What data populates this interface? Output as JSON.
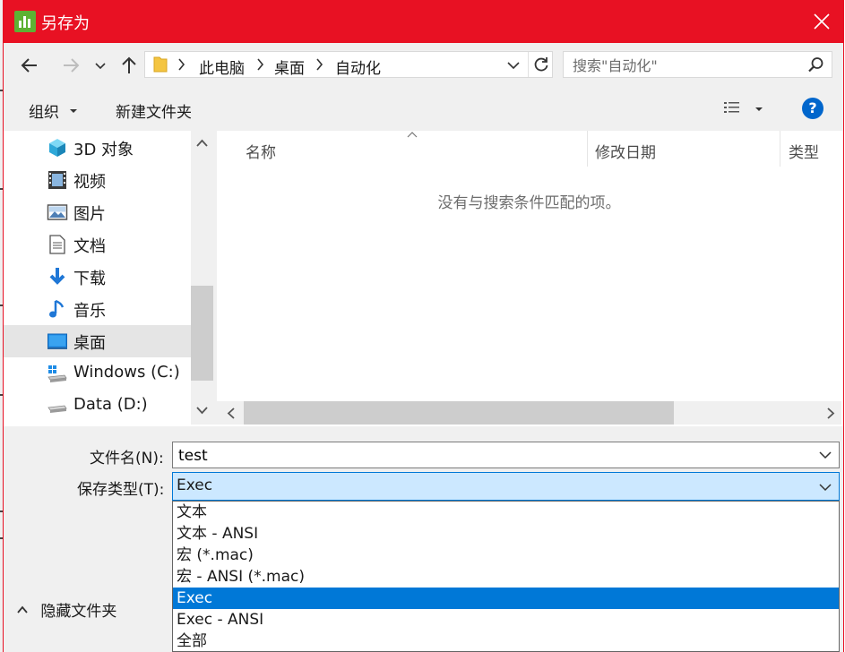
{
  "window": {
    "title": "另存为",
    "accent_color": "#e81123",
    "title_icon": "bar-chart-app-icon"
  },
  "navigation": {
    "back_icon": "arrow-left-icon",
    "forward_icon": "arrow-right-icon",
    "recent_icon": "chevron-down-icon",
    "up_icon": "arrow-up-icon",
    "breadcrumb": [
      "此电脑",
      "桌面",
      "自动化"
    ],
    "refresh_icon": "refresh-icon",
    "search_placeholder": "搜索\"自动化\""
  },
  "toolbar": {
    "organize_label": "组织",
    "new_folder_label": "新建文件夹",
    "help_label": "?"
  },
  "sidebar": {
    "items": [
      {
        "label": "3D 对象",
        "icon": "cube-3d-icon",
        "selected": false
      },
      {
        "label": "视频",
        "icon": "film-icon",
        "selected": false
      },
      {
        "label": "图片",
        "icon": "picture-icon",
        "selected": false
      },
      {
        "label": "文档",
        "icon": "document-icon",
        "selected": false
      },
      {
        "label": "下载",
        "icon": "download-arrow-icon",
        "selected": false
      },
      {
        "label": "音乐",
        "icon": "music-note-icon",
        "selected": false
      },
      {
        "label": "桌面",
        "icon": "desktop-icon",
        "selected": true
      },
      {
        "label": "Windows (C:)",
        "icon": "windows-drive-icon",
        "selected": false
      },
      {
        "label": "Data (D:)",
        "icon": "drive-icon",
        "selected": false
      }
    ]
  },
  "file_list": {
    "columns": [
      "名称",
      "修改日期",
      "类型"
    ],
    "empty_message": "没有与搜索条件匹配的项。"
  },
  "form": {
    "filename_label": "文件名(N):",
    "filename_value": "test",
    "filetype_label": "保存类型(T):",
    "filetype_value": "Exec",
    "filetype_options": [
      {
        "label": "文本",
        "selected": false
      },
      {
        "label": "文本 - ANSI",
        "selected": false
      },
      {
        "label": "宏 (*.mac)",
        "selected": false
      },
      {
        "label": "宏 - ANSI (*.mac)",
        "selected": false
      },
      {
        "label": "Exec",
        "selected": true
      },
      {
        "label": "Exec - ANSI",
        "selected": false
      },
      {
        "label": "全部",
        "selected": false
      }
    ],
    "hide_folders_label": "隐藏文件夹"
  }
}
